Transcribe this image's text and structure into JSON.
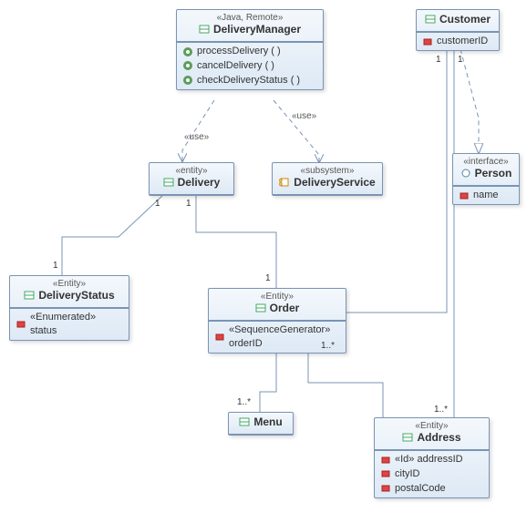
{
  "classes": {
    "deliveryManager": {
      "stereotype": "«Java, Remote»",
      "name": "DeliveryManager",
      "methods": [
        "processDelivery ( )",
        "cancelDelivery ( )",
        "checkDeliveryStatus ( )"
      ]
    },
    "customer": {
      "name": "Customer",
      "attrs": [
        "customerID"
      ]
    },
    "delivery": {
      "stereotype": "«entity»",
      "name": "Delivery"
    },
    "deliveryService": {
      "stereotype": "«subsystem»",
      "name": "DeliveryService"
    },
    "person": {
      "stereotype": "«interface»",
      "name": "Person",
      "attrs": [
        "name"
      ]
    },
    "deliveryStatus": {
      "stereotype": "«Entity»",
      "name": "DeliveryStatus",
      "attrs": [
        "«Enumerated» status"
      ]
    },
    "order": {
      "stereotype": "«Entity»",
      "name": "Order",
      "attrs": [
        "«SequenceGenerator» orderID"
      ]
    },
    "menu": {
      "name": "Menu"
    },
    "address": {
      "stereotype": "«Entity»",
      "name": "Address",
      "attrs": [
        "«Id» addressID",
        "cityID",
        "postalCode"
      ]
    }
  },
  "labels": {
    "use1": "«use»",
    "use2": "«use»"
  },
  "mult": {
    "d_ds_left": "1",
    "d_ds_bottom": "1",
    "d_o_left": "1",
    "d_o_right": "1",
    "cust_order": "1",
    "cust_addr": "1",
    "order_addr_l": "1..*",
    "order_addr_r": "1..*",
    "order_menu": "1..*"
  }
}
